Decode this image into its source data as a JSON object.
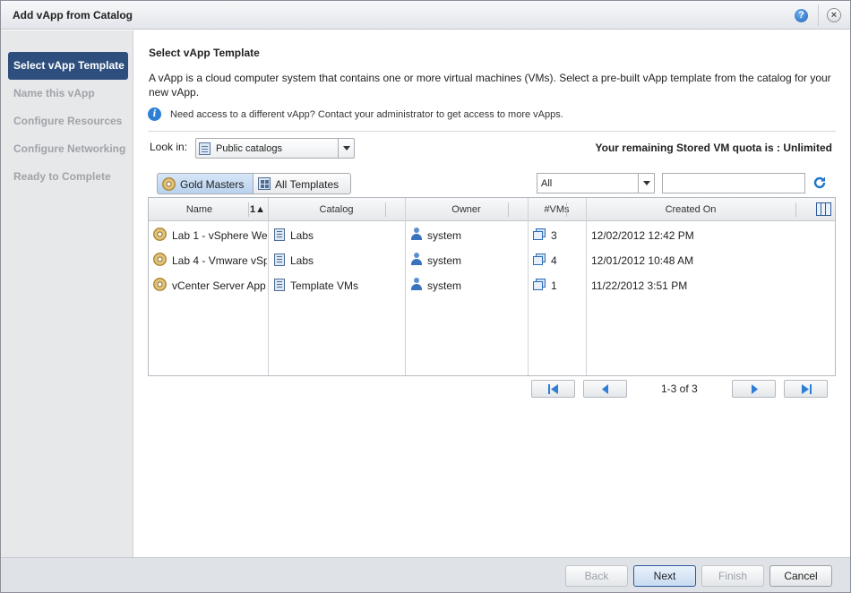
{
  "dialog": {
    "title": "Add vApp from Catalog"
  },
  "steps": [
    {
      "label": "Select vApp Template",
      "active": true
    },
    {
      "label": "Name this vApp",
      "active": false
    },
    {
      "label": "Configure Resources",
      "active": false
    },
    {
      "label": "Configure Networking",
      "active": false
    },
    {
      "label": "Ready to Complete",
      "active": false
    }
  ],
  "main": {
    "heading": "Select vApp Template",
    "description": "A vApp is a cloud computer system that contains one or more virtual machines (VMs). Select a pre-built vApp template from the catalog for your new vApp.",
    "info": "Need access to a different vApp? Contact your administrator to get access to more vApps.",
    "look_in_label": "Look in:",
    "look_in_value": "Public catalogs",
    "quota": "Your remaining Stored VM quota is : Unlimited",
    "view_tabs": [
      "Gold Masters",
      "All Templates"
    ],
    "filter_value": "All",
    "search_value": ""
  },
  "grid": {
    "columns": [
      "Name",
      "Catalog",
      "Owner",
      "#VMs",
      "Created On"
    ],
    "sort_indicator": "1",
    "rows": [
      {
        "name": "Lab 1 - vSphere We",
        "catalog": "Labs",
        "owner": "system",
        "vms": "3",
        "created": "12/02/2012 12:42 PM"
      },
      {
        "name": "Lab 4 - Vmware vSp",
        "catalog": "Labs",
        "owner": "system",
        "vms": "4",
        "created": "12/01/2012 10:48 AM"
      },
      {
        "name": "vCenter Server App",
        "catalog": "Template VMs",
        "owner": "system",
        "vms": "1",
        "created": "11/22/2012 3:51 PM"
      }
    ]
  },
  "pager": {
    "text": "1-3 of 3"
  },
  "footer": {
    "back": "Back",
    "next": "Next",
    "finish": "Finish",
    "cancel": "Cancel"
  },
  "icons": [
    "help-icon",
    "close-icon",
    "info-icon",
    "catalog-icon",
    "dropdown-arrow-icon",
    "gold-master-icon",
    "template-icon",
    "refresh-icon",
    "column-picker-icon",
    "user-icon",
    "vm-icon",
    "first-page-icon",
    "prev-page-icon",
    "next-page-icon",
    "last-page-icon"
  ],
  "colors": {
    "active_step": "#2e4f7d",
    "accent_blue": "#2d7fd6",
    "sidebar_bg": "#e7e8ea",
    "footer_bg": "#dfe2e6"
  }
}
